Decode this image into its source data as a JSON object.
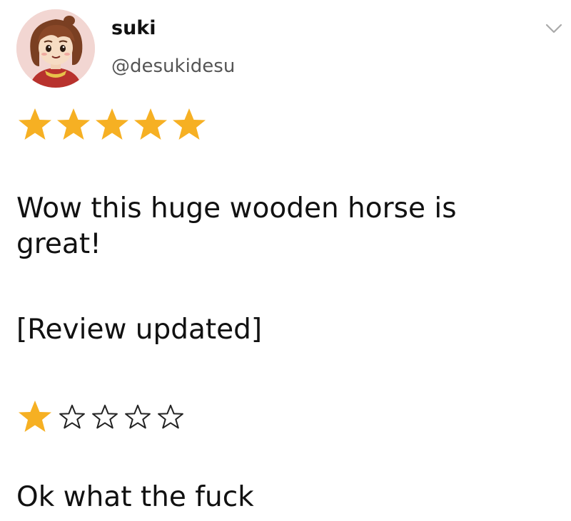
{
  "header": {
    "display_name": "suki",
    "handle": "@desukidesu",
    "avatar_icon": "cartoon-girl-avatar",
    "menu_icon": "chevron-down-icon"
  },
  "original_rating": {
    "value": 5,
    "out_of": 5,
    "filled_color": "#F6B023"
  },
  "review": {
    "text": "Wow this huge wooden horse is great!",
    "update_note": "[Review updated]",
    "final_text": "Ok what the fuck"
  },
  "updated_rating": {
    "value": 1,
    "out_of": 5,
    "filled_color": "#F6B023",
    "empty_glyph": "☆"
  }
}
